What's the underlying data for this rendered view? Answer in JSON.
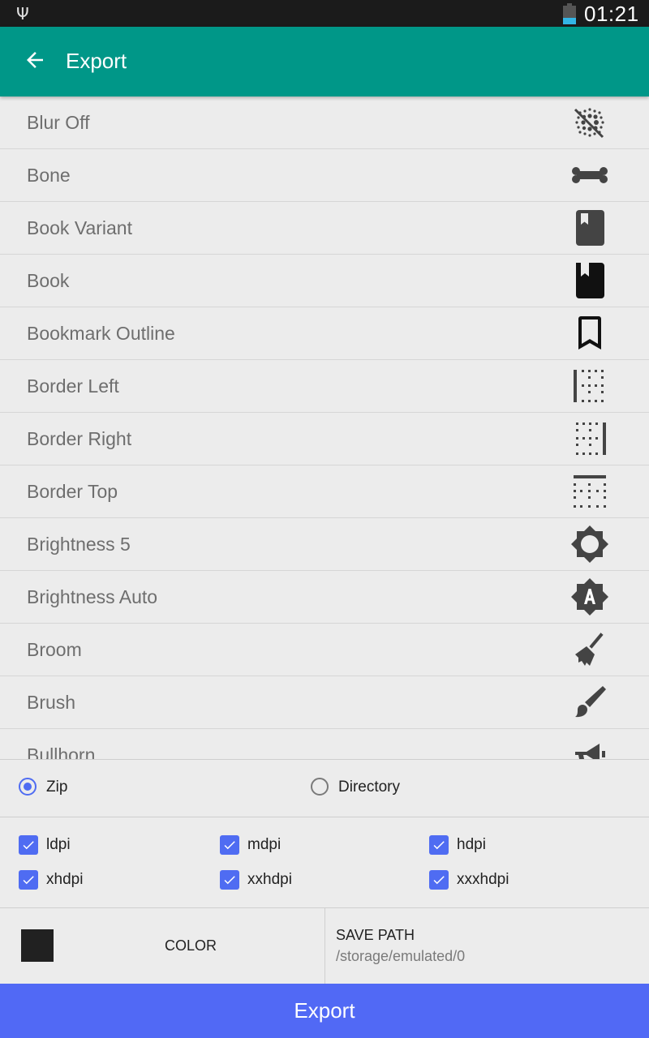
{
  "status_bar": {
    "usb_icon": "usb-icon",
    "battery_icon": "battery-icon",
    "time": "01:21"
  },
  "app_bar": {
    "back_icon": "arrow-left-icon",
    "title": "Export",
    "background": "#009788"
  },
  "icon_list": [
    {
      "label": "Blur Off",
      "icon": "blur-off-icon"
    },
    {
      "label": "Bone",
      "icon": "bone-icon"
    },
    {
      "label": "Book Variant",
      "icon": "book-variant-icon"
    },
    {
      "label": "Book",
      "icon": "book-icon"
    },
    {
      "label": "Bookmark Outline",
      "icon": "bookmark-outline-icon"
    },
    {
      "label": "Border Left",
      "icon": "border-left-icon"
    },
    {
      "label": "Border Right",
      "icon": "border-right-icon"
    },
    {
      "label": "Border Top",
      "icon": "border-top-icon"
    },
    {
      "label": "Brightness 5",
      "icon": "brightness-5-icon"
    },
    {
      "label": "Brightness Auto",
      "icon": "brightness-auto-icon"
    },
    {
      "label": "Broom",
      "icon": "broom-icon"
    },
    {
      "label": "Brush",
      "icon": "brush-icon"
    },
    {
      "label": "Bullhorn",
      "icon": "bullhorn-icon"
    }
  ],
  "format": {
    "options": [
      {
        "label": "Zip",
        "checked": true
      },
      {
        "label": "Directory",
        "checked": false
      }
    ]
  },
  "densities": [
    {
      "label": "ldpi",
      "checked": true
    },
    {
      "label": "mdpi",
      "checked": true
    },
    {
      "label": "hdpi",
      "checked": true
    },
    {
      "label": "xhdpi",
      "checked": true
    },
    {
      "label": "xxhdpi",
      "checked": true
    },
    {
      "label": "xxxhdpi",
      "checked": true
    }
  ],
  "options": {
    "color_label": "COLOR",
    "color_value": "#212121",
    "save_path_title": "SAVE PATH",
    "save_path_value": "/storage/emulated/0"
  },
  "export_button": {
    "label": "Export",
    "color": "#5169f5"
  },
  "accent_color": "#4f6cf2"
}
